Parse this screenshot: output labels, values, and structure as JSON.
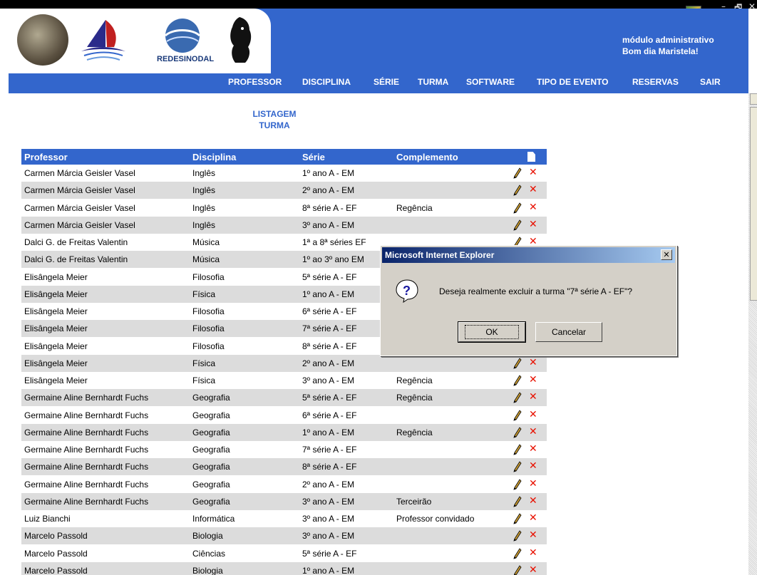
{
  "header": {
    "title": "módulo administrativo",
    "greeting": "Bom dia Maristela!",
    "logo3_text": "REDESINODAL"
  },
  "window_controls": {
    "minimize": "–",
    "restore": "🗗",
    "close": "✕"
  },
  "nav": {
    "items": [
      "PROFESSOR",
      "DISCIPLINA",
      "SÉRIE",
      "TURMA",
      "SOFTWARE",
      "TIPO DE EVENTO",
      "RESERVAS",
      "SAIR"
    ]
  },
  "listing": {
    "line1": "LISTAGEM",
    "line2": "TURMA"
  },
  "table": {
    "headers": {
      "professor": "Professor",
      "disciplina": "Disciplina",
      "serie": "Série",
      "complemento": "Complemento"
    },
    "rows": [
      {
        "professor": "Carmen Márcia Geisler Vasel",
        "disciplina": "Inglês",
        "serie": "1º ano A - EM",
        "complemento": ""
      },
      {
        "professor": "Carmen Márcia Geisler Vasel",
        "disciplina": "Inglês",
        "serie": "2º ano A - EM",
        "complemento": ""
      },
      {
        "professor": "Carmen Márcia Geisler Vasel",
        "disciplina": "Inglês",
        "serie": "8ª série A - EF",
        "complemento": "Regência"
      },
      {
        "professor": "Carmen Márcia Geisler Vasel",
        "disciplina": "Inglês",
        "serie": "3º ano A - EM",
        "complemento": ""
      },
      {
        "professor": "Dalci G. de Freitas Valentin",
        "disciplina": "Música",
        "serie": "1ª a 8ª séries EF",
        "complemento": ""
      },
      {
        "professor": "Dalci G. de Freitas Valentin",
        "disciplina": "Música",
        "serie": "1º ao 3º ano EM",
        "complemento": ""
      },
      {
        "professor": "Elisângela Meier",
        "disciplina": "Filosofia",
        "serie": "5ª série A - EF",
        "complemento": ""
      },
      {
        "professor": "Elisângela Meier",
        "disciplina": "Física",
        "serie": "1º ano A - EM",
        "complemento": ""
      },
      {
        "professor": "Elisângela Meier",
        "disciplina": "Filosofia",
        "serie": "6ª série A - EF",
        "complemento": ""
      },
      {
        "professor": "Elisângela Meier",
        "disciplina": "Filosofia",
        "serie": "7ª série A - EF",
        "complemento": ""
      },
      {
        "professor": "Elisângela Meier",
        "disciplina": "Filosofia",
        "serie": "8ª série A - EF",
        "complemento": ""
      },
      {
        "professor": "Elisângela Meier",
        "disciplina": "Física",
        "serie": "2º ano A - EM",
        "complemento": ""
      },
      {
        "professor": "Elisângela Meier",
        "disciplina": "Física",
        "serie": "3º ano A - EM",
        "complemento": "Regência"
      },
      {
        "professor": "Germaine Aline Bernhardt Fuchs",
        "disciplina": "Geografia",
        "serie": "5ª série A - EF",
        "complemento": "Regência"
      },
      {
        "professor": "Germaine Aline Bernhardt Fuchs",
        "disciplina": "Geografia",
        "serie": "6ª série A - EF",
        "complemento": ""
      },
      {
        "professor": "Germaine Aline Bernhardt Fuchs",
        "disciplina": "Geografia",
        "serie": "1º ano A - EM",
        "complemento": "Regência"
      },
      {
        "professor": "Germaine Aline Bernhardt Fuchs",
        "disciplina": "Geografia",
        "serie": "7ª série A - EF",
        "complemento": ""
      },
      {
        "professor": "Germaine Aline Bernhardt Fuchs",
        "disciplina": "Geografia",
        "serie": "8ª série A - EF",
        "complemento": ""
      },
      {
        "professor": "Germaine Aline Bernhardt Fuchs",
        "disciplina": "Geografia",
        "serie": "2º ano A - EM",
        "complemento": ""
      },
      {
        "professor": "Germaine Aline Bernhardt Fuchs",
        "disciplina": "Geografia",
        "serie": "3º ano A - EM",
        "complemento": "Terceirão"
      },
      {
        "professor": "Luiz Bianchi",
        "disciplina": "Informática",
        "serie": "3º ano A - EM",
        "complemento": "Professor convidado"
      },
      {
        "professor": "Marcelo Passold",
        "disciplina": "Biologia",
        "serie": "3º ano A - EM",
        "complemento": ""
      },
      {
        "professor": "Marcelo Passold",
        "disciplina": "Ciências",
        "serie": "5ª série A - EF",
        "complemento": ""
      },
      {
        "professor": "Marcelo Passold",
        "disciplina": "Biologia",
        "serie": "1º ano A - EM",
        "complemento": ""
      }
    ],
    "row_icons": {
      "edit": "pencil-icon",
      "delete": "delete-x-icon"
    },
    "delete_glyph": "✕"
  },
  "dialog": {
    "title": "Microsoft Internet Explorer",
    "message": "Deseja realmente excluir a turma \"7ª série A - EF\"?",
    "ok_label": "OK",
    "cancel_label": "Cancelar",
    "close_glyph": "✕",
    "icon": "question-icon"
  },
  "colors": {
    "accent": "#3366cc",
    "row_alt": "#dcdcdc",
    "delete": "#e81000"
  }
}
